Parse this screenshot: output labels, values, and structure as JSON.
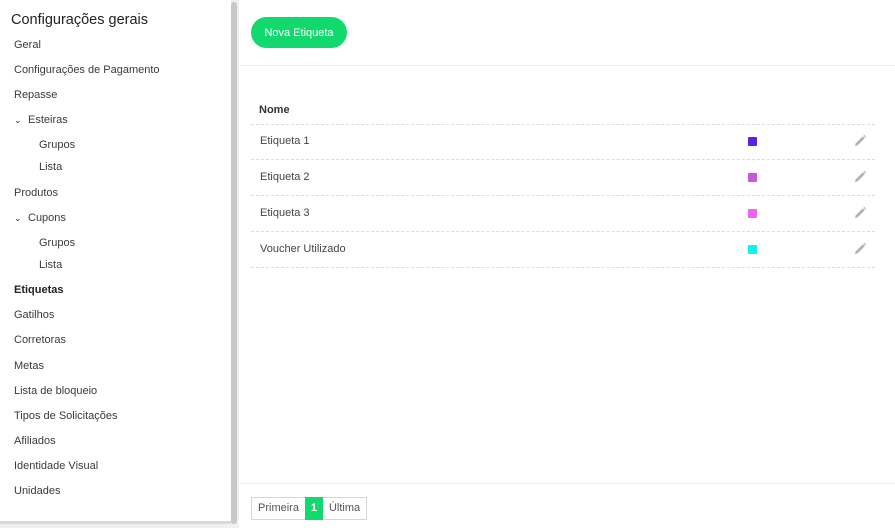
{
  "sidebar": {
    "title": "Configurações gerais",
    "items": {
      "geral": "Geral",
      "pagamento": "Configurações de Pagamento",
      "repasse": "Repasse",
      "esteiras": "Esteiras",
      "esteiras_grupos": "Grupos",
      "esteiras_lista": "Lista",
      "produtos": "Produtos",
      "cupons": "Cupons",
      "cupons_grupos": "Grupos",
      "cupons_lista": "Lista",
      "etiquetas": "Etiquetas",
      "gatilhos": "Gatilhos",
      "corretoras": "Corretoras",
      "metas": "Metas",
      "lista_bloqueio": "Lista de bloqueio",
      "tipos_solicitacoes": "Tipos de Solicitações",
      "afiliados": "Afiliados",
      "identidade_visual": "Identidade Visual",
      "unidades": "Unidades"
    },
    "active": "Etiquetas",
    "chevron_icon": "chevron-down-icon"
  },
  "toolbar": {
    "new_button_label": "Nova Etiqueta"
  },
  "table": {
    "header_name": "Nome",
    "rows": [
      {
        "name": "Etiqueta 1",
        "color": "#5b21e6"
      },
      {
        "name": "Etiqueta 2",
        "color": "#c45ad6"
      },
      {
        "name": "Etiqueta 3",
        "color": "#f062f0"
      },
      {
        "name": "Voucher Utilizado",
        "color": "#13f0f0"
      }
    ],
    "row_action_icon": "pencil-icon"
  },
  "pagination": {
    "first": "Primeira",
    "current": "1",
    "last": "Última"
  },
  "colors": {
    "accent": "#12d96e"
  }
}
